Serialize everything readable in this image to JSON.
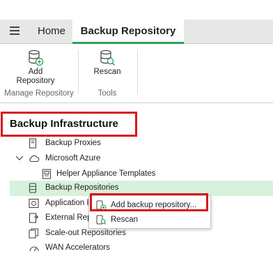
{
  "tabs": {
    "home": "Home",
    "active": "Backup Repository"
  },
  "ribbon": {
    "add_repository_line1": "Add",
    "add_repository_line2": "Repository",
    "rescan": "Rescan",
    "group_manage": "Manage Repository",
    "group_tools": "Tools"
  },
  "tree": {
    "heading": "Backup Infrastructure",
    "items": [
      "Backup Proxies",
      "Microsoft Azure",
      "Helper Appliance Templates",
      "Backup Repositories",
      "Application B",
      "External Repo",
      "Scale-out Repositories",
      "WAN Accelerators"
    ]
  },
  "context_menu": {
    "add": "Add backup repository...",
    "rescan": "Rescan"
  },
  "colors": {
    "accent": "#2f9f57",
    "highlight": "#d9151b",
    "selected_row": "#d7f1dc"
  }
}
